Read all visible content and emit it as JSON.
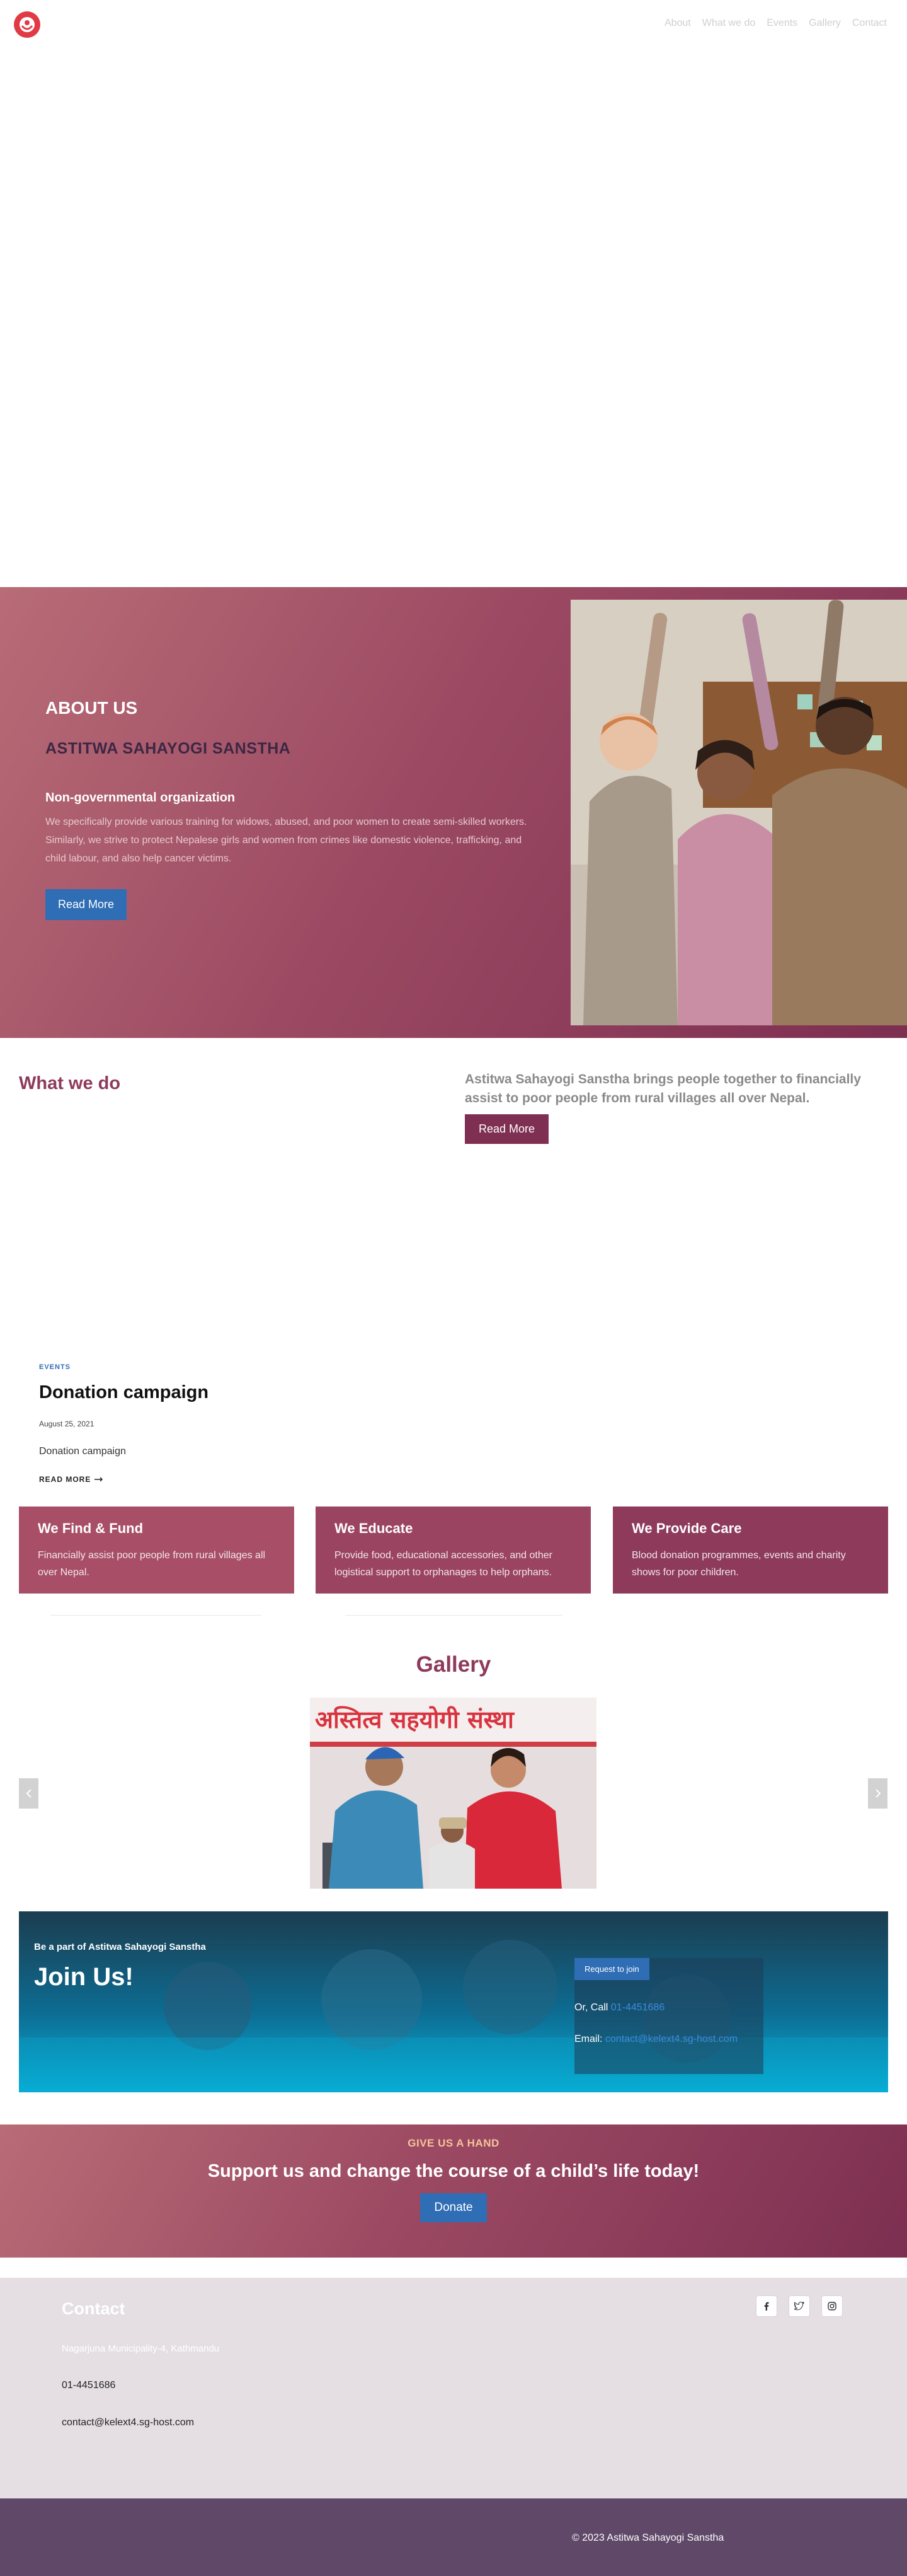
{
  "header": {
    "logo_alt": "Astitwa Sahayogi Sanstha logo",
    "nav": [
      "About",
      "What we do",
      "Events",
      "Gallery",
      "Contact"
    ]
  },
  "about": {
    "eyebrow": "ABOUT US",
    "title": "ASTITWA SAHAYOGI SANSTHA",
    "subtitle": "Non-governmental organization",
    "description": "We specifically provide various training for widows, abused, and poor women to create semi-skilled workers. Similarly, we strive to protect Nepalese girls and women from crimes like domestic violence, trafficking, and child labour, and also help cancer victims.",
    "button": "Read More"
  },
  "what_we_do": {
    "title": "What we do",
    "description": "Astitwa Sahayogi Sanstha brings people together to financially assist to poor people from rural villages all over Nepal.",
    "button": "Read More"
  },
  "event": {
    "tag": "EVENTS",
    "title": "Donation campaign",
    "date": "August 25, 2021",
    "excerpt": "Donation campaign",
    "more": "READ MORE"
  },
  "services": [
    {
      "title": "We Find & Fund",
      "text": "Financially assist poor people from rural villages all over Nepal."
    },
    {
      "title": "We Educate",
      "text": "Provide food, educational accessories, and other logistical support to orphanages to help orphans."
    },
    {
      "title": "We Provide Care",
      "text": "Blood donation programmes, events and charity shows for poor children."
    }
  ],
  "gallery": {
    "title": "Gallery",
    "banner_text": "अस्तित्व सहयोगी संस्था"
  },
  "join": {
    "kicker": "Be a part of Astitwa Sahayogi Sanstha",
    "title": "Join Us!",
    "button": "Request to join",
    "call_label": "Or, Call",
    "call_value": "01-4451686",
    "email_label": "Email:",
    "email_value": "contact@kelext4.sg-host.com"
  },
  "donate": {
    "kicker": "GIVE US A HAND",
    "title": "Support us and change the course of a child’s life today!",
    "button": "Donate"
  },
  "contact": {
    "title": "Contact",
    "address": "Nagarjuna Municipality-4, Kathmandu",
    "phone": "01-4451686",
    "email": "contact@kelext4.sg-host.com"
  },
  "footer": {
    "copyright": "© 2023 Astitwa Sahayogi Sanstha"
  },
  "colors": {
    "plum": "#7e2f52",
    "rose": "#b86c76",
    "blue": "#2f6db5",
    "footer": "#5f4868",
    "contact_bg": "#e5dfe3"
  }
}
